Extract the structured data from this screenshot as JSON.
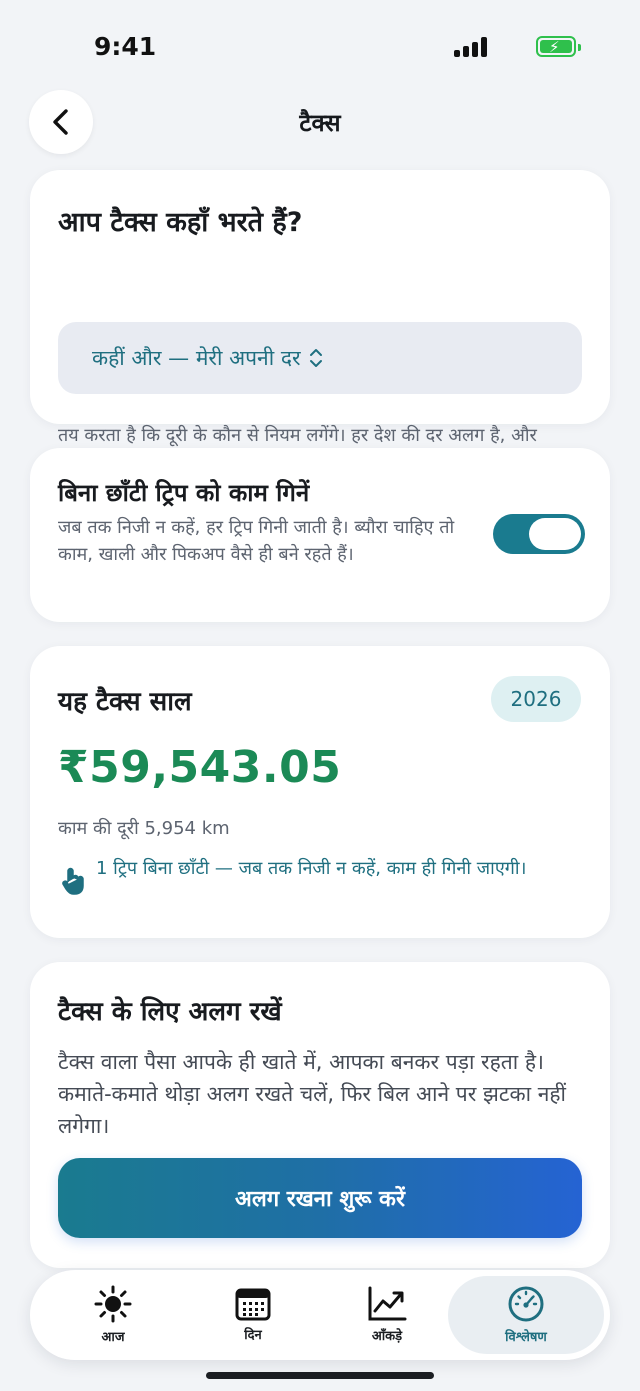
{
  "status_bar": {
    "time": "9:41"
  },
  "header": {
    "title": "टैक्स"
  },
  "region_card": {
    "title": "आप टैक्स कहाँ भरते हैं?",
    "description": "तय करता है कि दूरी के कौन से नियम लगेंगे। हर देश की दर अलग है, और अपनी दर बदली जा सकती है।",
    "selected": "कहीं और — मेरी अपनी दर"
  },
  "count_card": {
    "title": "बिना छाँटी ट्रिप को काम गिनें",
    "description": "जब तक निजी न कहें, हर ट्रिप गिनी जाती है। ब्यौरा चाहिए तो काम, खाली और पिकअप वैसे ही बने रहते हैं।",
    "toggle_on": true
  },
  "year_card": {
    "title": "यह टैक्स साल",
    "year": "2026",
    "amount": "₹59,543.05",
    "distance": "काम की दूरी 5,954 km",
    "note": "1 ट्रिप बिना छाँटी — जब तक निजी न कहें, काम ही गिनी जाएगी।"
  },
  "setaside_card": {
    "title": "टैक्स के लिए अलग रखें",
    "description": "टैक्स वाला पैसा आपके ही खाते में, आपका बनकर पड़ा रहता है। कमाते-कमाते थोड़ा अलग रखते चलें, फिर बिल आने पर झटका नहीं लगेगा।",
    "button": "अलग रखना शुरू करें"
  },
  "tab_bar": {
    "tabs": [
      {
        "label": "आज",
        "icon": "sun-icon"
      },
      {
        "label": "दिन",
        "icon": "calendar-icon"
      },
      {
        "label": "आँकड़े",
        "icon": "chart-icon"
      },
      {
        "label": "विश्लेषण",
        "icon": "gauge-icon",
        "active": true
      }
    ]
  },
  "colors": {
    "accent": "#1a7b8f",
    "amount": "#1b8a56",
    "button_end": "#2563d3",
    "battery": "#2fc04c"
  }
}
